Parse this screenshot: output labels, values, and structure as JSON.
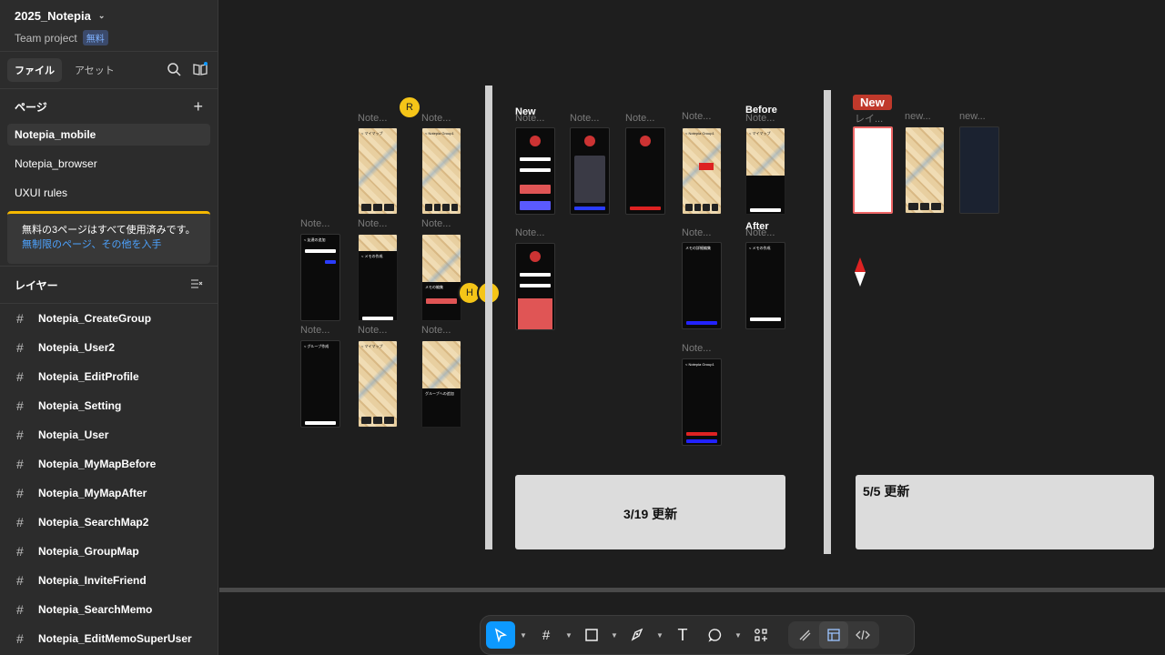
{
  "project": {
    "name": "2025_Notepia",
    "team": "Team project",
    "plan_badge": "無料"
  },
  "tabs": {
    "file": "ファイル",
    "assets": "アセット"
  },
  "pages": {
    "title": "ページ",
    "items": [
      "Notepia_mobile",
      "Notepia_browser",
      "UXUI rules"
    ]
  },
  "notice": {
    "text": "無料の3ページはすべて使用済みです。",
    "link": "無制限のページ、その他を入手"
  },
  "layers": {
    "title": "レイヤー",
    "items": [
      "Notepia_CreateGroup",
      "Notepia_User2",
      "Notepia_EditProfile",
      "Notepia_Setting",
      "Notepia_User",
      "Notepia_MyMapBefore",
      "Notepia_MyMapAfter",
      "Notepia_SearchMap2",
      "Notepia_GroupMap",
      "Notepia_InviteFriend",
      "Notepia_SearchMemo",
      "Notepia_EditMemoSuperUser"
    ]
  },
  "canvas": {
    "frame_label": "Note...",
    "frame_label_layer": "レイ...",
    "frame_label_new": "new...",
    "tag_new_1": "New",
    "tag_before": "Before",
    "tag_after": "After",
    "tag_new_2": "New",
    "update_1": "3/19 更新",
    "update_2": "5/5 更新",
    "avatars": [
      "R",
      "H",
      "R"
    ],
    "phone_texts": {
      "mymap": "< マイマップ",
      "group": "< Notepia Group1",
      "friends": "< 友達の追加",
      "create_group": "< グループ作成",
      "memo_create": "< メモの作成",
      "memo_edit": "メモの編集",
      "group_map": "グループへの追加",
      "memo_detail": "メモの詳細編集"
    }
  },
  "toolbar": {
    "tools": [
      "move-tool",
      "frame-tool",
      "shape-tool",
      "pen-tool",
      "text-tool",
      "comment-tool",
      "actions-tool",
      "draw-mode",
      "design-mode",
      "dev-mode"
    ]
  }
}
